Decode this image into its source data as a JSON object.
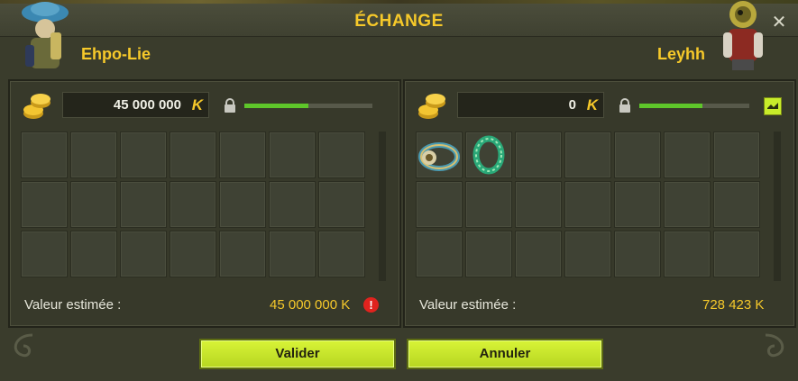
{
  "window": {
    "title": "ÉCHANGE",
    "close_glyph": "✕"
  },
  "colors": {
    "accent": "#f6c92a",
    "button": "#c8e82c",
    "progress": "#5ec62a",
    "warning": "#e0231e"
  },
  "left": {
    "name": "Ehpo-Lie",
    "kamas": "45 000 000",
    "kamas_symbol": "K",
    "progress": 0.5,
    "value_label": "Valeur estimée :",
    "value": "45 000 000 K",
    "warning_glyph": "!",
    "items": []
  },
  "right": {
    "name": "Leyhh",
    "kamas": "0",
    "kamas_symbol": "K",
    "progress": 0.57,
    "value_label": "Valeur estimée :",
    "value": "728 423 K",
    "items": [
      "ring-item-gold",
      "ring-item-green"
    ]
  },
  "buttons": {
    "validate": "Valider",
    "cancel": "Annuler"
  },
  "icons": [
    "coins-icon",
    "kamas-icon",
    "lock-icon",
    "close-icon",
    "warning-icon",
    "ready-toggle-icon"
  ]
}
